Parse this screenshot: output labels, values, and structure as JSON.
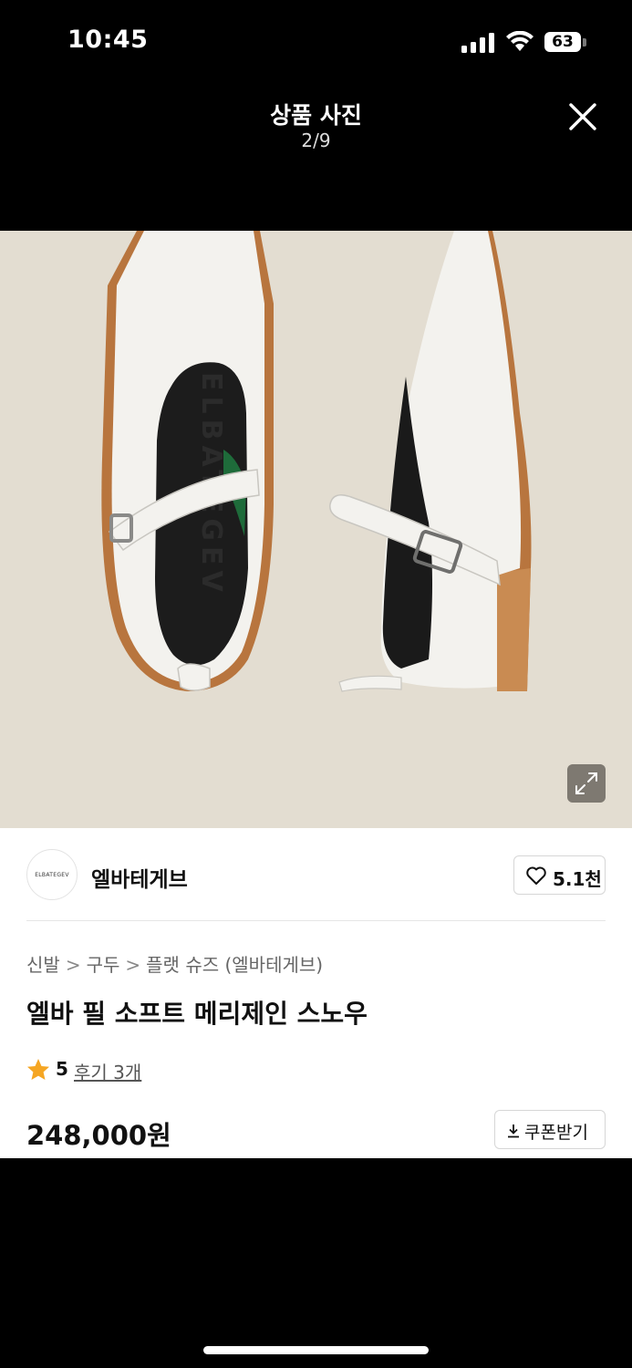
{
  "status_bar": {
    "time": "10:45",
    "battery": "63",
    "icons": [
      "signal-icon",
      "wifi-icon",
      "battery-icon"
    ]
  },
  "viewer": {
    "title": "상품 사진",
    "counter": "2/9",
    "close_icon": "close-icon",
    "expand_icon": "expand-icon"
  },
  "photo": {
    "subject": "product-photo",
    "insole_text": "ELBATEGEV"
  },
  "brand": {
    "logo_text": "ELBATEGEV",
    "name": "엘바테게브",
    "likes": "5.1천"
  },
  "breadcrumb": {
    "items": [
      "신발",
      "구두",
      "플랫 슈즈 (엘바테게브)"
    ],
    "separator": ">"
  },
  "product": {
    "title": "엘바 필 소프트 메리제인 스노우",
    "rating": "5",
    "reviews": "후기 3개",
    "price": "248,000원",
    "coupon_label": "쿠폰받기"
  },
  "colors": {
    "background": "#000000",
    "photo_background": "#e3ddd1",
    "star": "#f5a623",
    "text": "#111111"
  }
}
